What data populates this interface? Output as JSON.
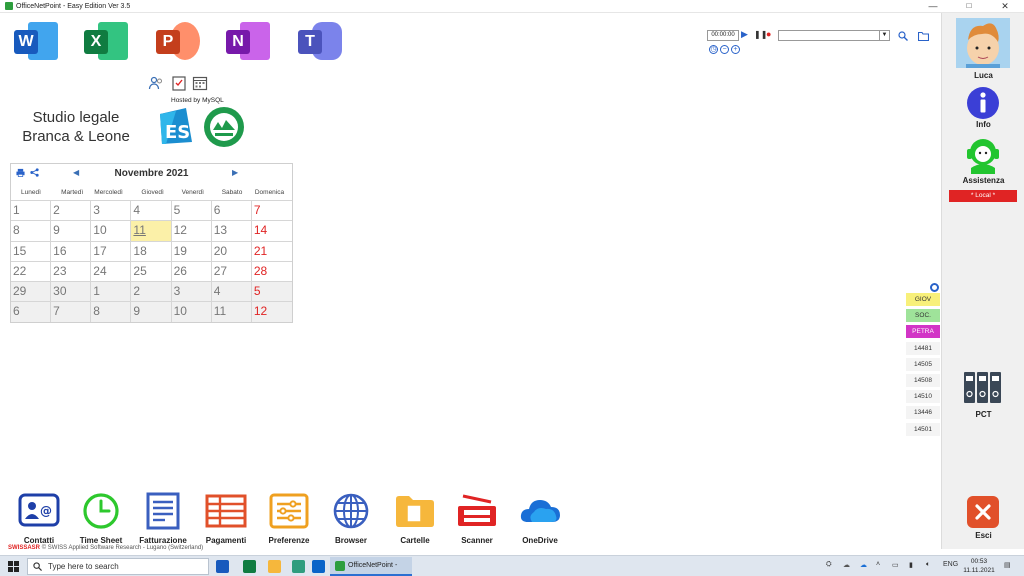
{
  "window": {
    "title": "OfficeNetPoint - Easy Edition Ver 3.5",
    "controls": [
      "—",
      "□",
      "✕"
    ]
  },
  "apps": [
    {
      "icon": "word-icon",
      "letter": "W",
      "color": "#185abd",
      "back": "#41a5ee"
    },
    {
      "icon": "excel-icon",
      "letter": "X",
      "color": "#107c41",
      "back": "#33c481"
    },
    {
      "icon": "powerpoint-icon",
      "letter": "P",
      "color": "#c43e1c",
      "back": "#ff8f6b"
    },
    {
      "icon": "onenote-icon",
      "letter": "N",
      "color": "#7719aa",
      "back": "#ca64ea"
    },
    {
      "icon": "teams-icon",
      "letter": "T",
      "color": "#4b53bc",
      "back": "#7b83eb"
    }
  ],
  "hosted": "Hosted by MySQL",
  "studio": {
    "line1": "Studio legale",
    "line2": "Branca & Leone"
  },
  "calendar": {
    "month": "Novembre 2021",
    "prev": "◀",
    "next": "▶",
    "weekdays": [
      "Lunedì",
      "Martedì",
      "Mercoledì",
      "Giovedì",
      "Venerdì",
      "Sabato",
      "Domenica"
    ],
    "weeks": [
      [
        "1",
        "2",
        "3",
        "4",
        "5",
        "6",
        "7"
      ],
      [
        "8",
        "9",
        "10",
        "11",
        "12",
        "13",
        "14"
      ],
      [
        "15",
        "16",
        "17",
        "18",
        "19",
        "20",
        "21"
      ],
      [
        "22",
        "23",
        "24",
        "25",
        "26",
        "27",
        "28"
      ],
      [
        "29",
        "30",
        "1",
        "2",
        "3",
        "4",
        "5"
      ],
      [
        "6",
        "7",
        "8",
        "9",
        "10",
        "11",
        "12"
      ]
    ],
    "other_month_rows": [
      4,
      5
    ],
    "today": "11"
  },
  "toolbar": {
    "timer": "00:00:00"
  },
  "sidebar": {
    "user": "Luca",
    "info": "Info",
    "assistenza": "Assistenza",
    "local": "* Local *",
    "pct": "PCT",
    "esci": "Esci"
  },
  "tags": [
    {
      "label": "GIOV",
      "bg": "#f8f07a"
    },
    {
      "label": "SOC.",
      "bg": "#9fe39a"
    },
    {
      "label": "PETRA",
      "bg": "#d235c6",
      "fg": "#ffffff"
    },
    {
      "label": "14481"
    },
    {
      "label": "14505"
    },
    {
      "label": "14508"
    },
    {
      "label": "14510"
    },
    {
      "label": "13446"
    },
    {
      "label": "14501"
    }
  ],
  "bottom": {
    "contatti": "Contatti",
    "timesheet": "Time Sheet",
    "fatturazione": "Fatturazione",
    "pagamenti": "Pagamenti",
    "preferenze": "Preferenze",
    "browser": "Browser",
    "cartelle": "Cartelle",
    "scanner": "Scanner",
    "onedrive": "OneDrive"
  },
  "footer": {
    "brand": "SWISSASR",
    "copy": "© SWISS Applied Software Research - Lugano (Switzerland)"
  },
  "taskbar": {
    "search_placeholder": "Type here to search",
    "active_app": "OfficeNetPoint - Ea...",
    "lang": "ENG",
    "time": "00:53",
    "date": "11.11.2021"
  },
  "colors": {
    "accent": "#2962c9",
    "sunday": "#e02424"
  }
}
